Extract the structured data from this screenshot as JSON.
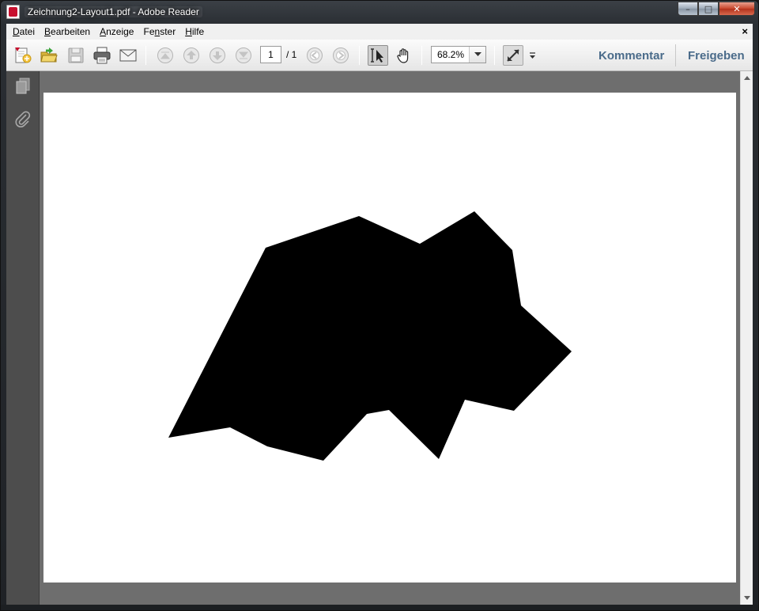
{
  "window": {
    "title": "Zeichnung2-Layout1.pdf - Adobe Reader",
    "controls": {
      "minimize": "–",
      "maximize": "□",
      "close": "✕"
    }
  },
  "menu": {
    "items": [
      {
        "label_u": "D",
        "label_rest": "atei"
      },
      {
        "label_u": "B",
        "label_rest": "earbeiten"
      },
      {
        "label_u": "A",
        "label_rest": "nzeige"
      },
      {
        "label_pre": "Fe",
        "label_u": "n",
        "label_rest": "ster"
      },
      {
        "label_u": "H",
        "label_rest": "ilfe"
      }
    ],
    "close_doc": "×"
  },
  "toolbar": {
    "page_current": "1",
    "page_total": "/ 1",
    "zoom": "68.2%",
    "kommentar": "Kommentar",
    "freigeben": "Freigeben",
    "icons": [
      "create-pdf-icon",
      "open-folder-icon",
      "save-disk-icon",
      "print-icon",
      "email-envelope-icon",
      "first-page-icon",
      "previous-page-icon",
      "next-page-icon",
      "last-page-icon",
      "previous-view-icon",
      "next-view-icon",
      "select-cursor-icon",
      "hand-tool-icon",
      "zoom-dropdown-icon",
      "fullscreen-icon",
      "toolbar-overflow-icon"
    ]
  },
  "navpane": {
    "icons": [
      "page-thumbnails-icon",
      "attachments-paperclip-icon"
    ]
  },
  "document": {
    "page_background": "#ffffff",
    "shape_fill": "#000000"
  }
}
